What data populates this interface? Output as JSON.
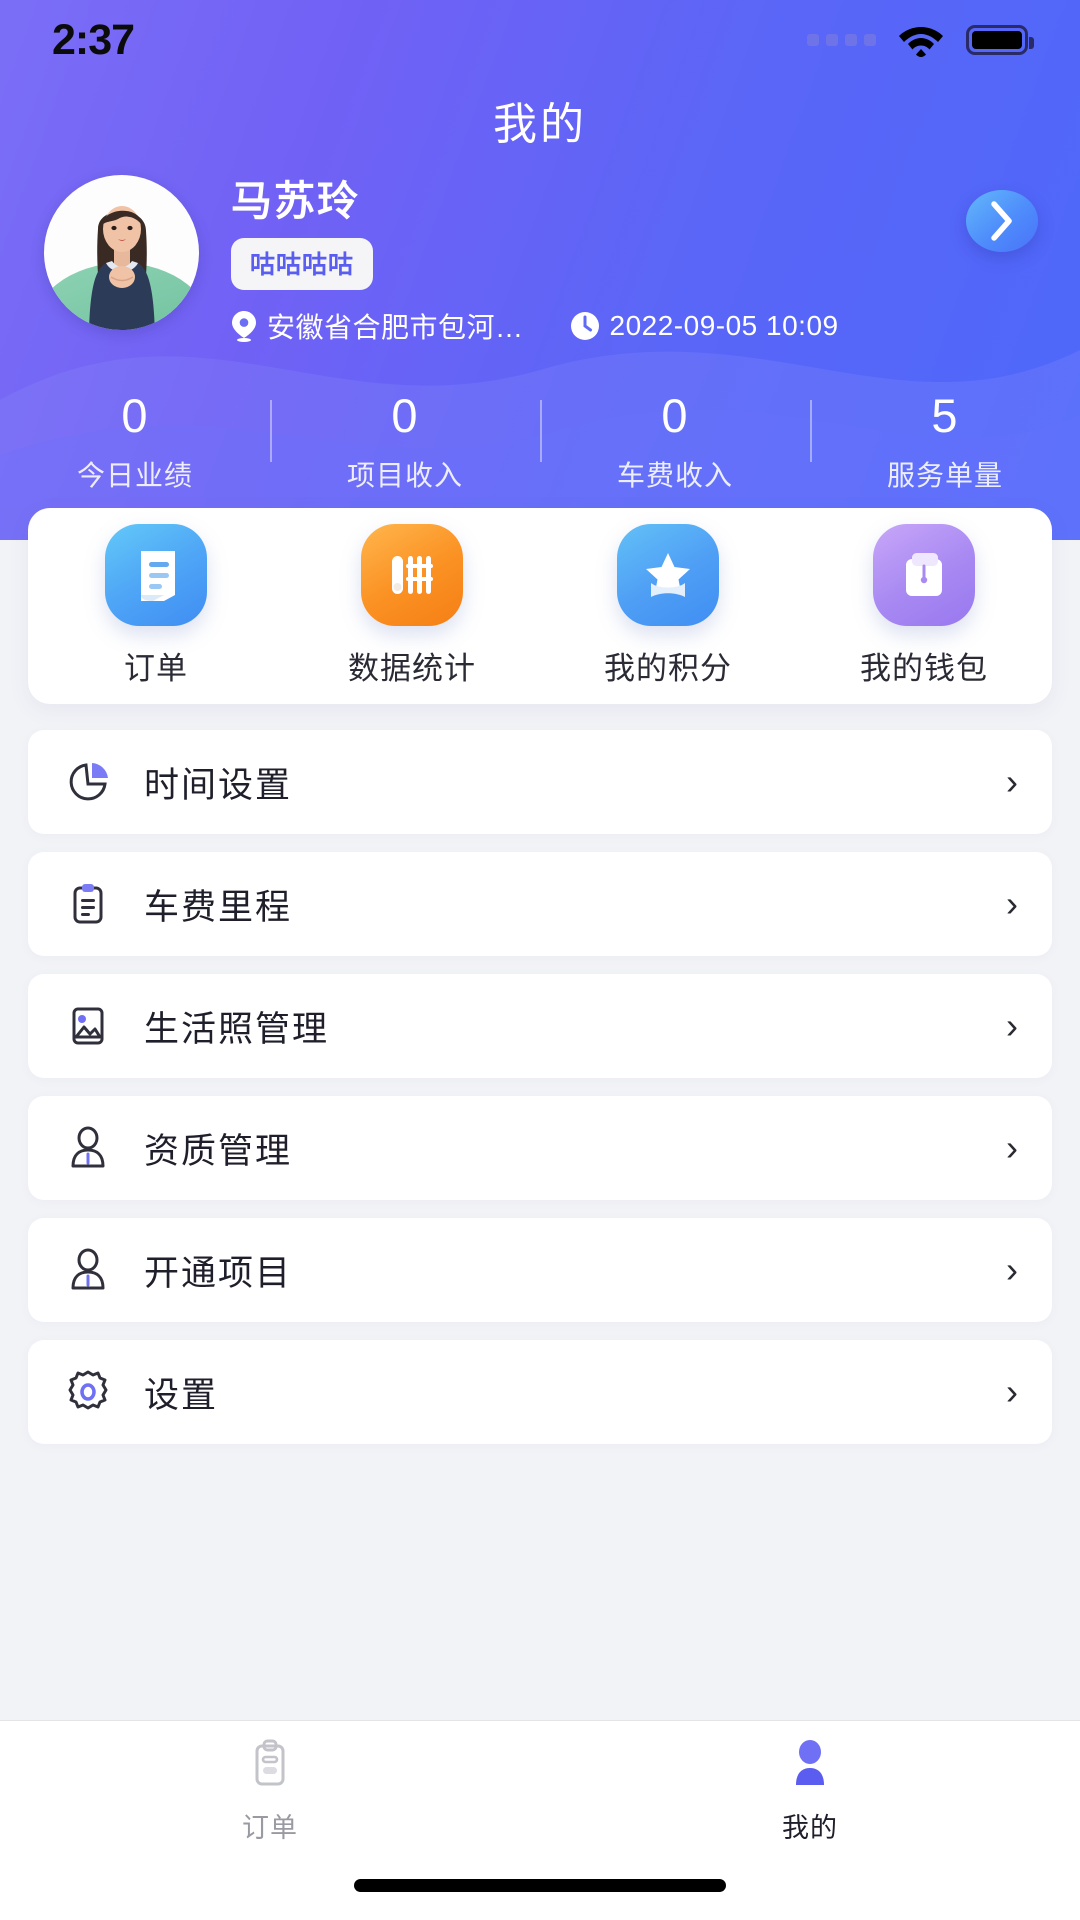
{
  "status_bar": {
    "time": "2:37",
    "signal_icon": "signal-dots-icon",
    "wifi_icon": "wifi-icon",
    "battery_icon": "battery-full-icon"
  },
  "header": {
    "title": "我的",
    "gradient_from": "#7b6ef6",
    "gradient_to": "#4d68fb"
  },
  "profile": {
    "avatar_name": "user-avatar",
    "name": "马苏玲",
    "tag": "咕咕咕咕",
    "location_icon": "location-pin-icon",
    "location": "安徽省合肥市包河…",
    "time_icon": "clock-icon",
    "time": "2022-09-05 10:09",
    "arrow_label": "›"
  },
  "stats": [
    {
      "value": "0",
      "label": "今日业绩"
    },
    {
      "value": "0",
      "label": "项目收入"
    },
    {
      "value": "0",
      "label": "车费收入"
    },
    {
      "value": "5",
      "label": "服务单量"
    }
  ],
  "quick_actions": [
    {
      "label": "订单",
      "icon": "receipt-icon",
      "color": "#4fa6f6"
    },
    {
      "label": "数据统计",
      "icon": "abacus-icon",
      "color": "#fb9224"
    },
    {
      "label": "我的积分",
      "icon": "star-badge-icon",
      "color": "#4f9ff5"
    },
    {
      "label": "我的钱包",
      "icon": "wallet-icon",
      "color": "#a98af2"
    }
  ],
  "menu": [
    {
      "label": "时间设置",
      "icon": "pie-chart-icon",
      "chevron": "›"
    },
    {
      "label": "车费里程",
      "icon": "clipboard-icon",
      "chevron": "›"
    },
    {
      "label": "生活照管理",
      "icon": "image-icon",
      "chevron": "›"
    },
    {
      "label": "资质管理",
      "icon": "user-badge-icon",
      "chevron": "›"
    },
    {
      "label": "开通项目",
      "icon": "user-badge-icon",
      "chevron": "›"
    },
    {
      "label": "设置",
      "icon": "gear-icon",
      "chevron": "›"
    }
  ],
  "tabbar": [
    {
      "label": "订单",
      "icon": "clipboard-icon",
      "active": false
    },
    {
      "label": "我的",
      "icon": "person-icon",
      "active": true
    }
  ],
  "colors": {
    "accent": "#5a5ef0",
    "tab_active": "#5b5cf0",
    "tab_inactive": "#c9c9cf"
  }
}
